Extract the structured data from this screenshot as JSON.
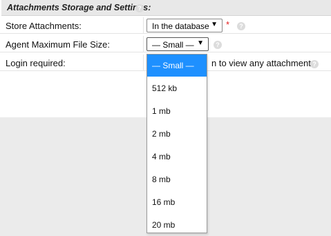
{
  "section": {
    "title": "Attachments Storage and Settings:"
  },
  "rows": [
    {
      "label": "Store Attachments:",
      "select_value": "In the database",
      "required_marker": "*"
    },
    {
      "label": "Agent Maximum File Size:",
      "select_value": "— Small —"
    },
    {
      "label": "Login required:",
      "description": "n to view any attachments"
    }
  ],
  "dropdown": {
    "options": [
      "— Small —",
      "512 kb",
      "1 mb",
      "2 mb",
      "4 mb",
      "8 mb",
      "16 mb",
      "20 mb"
    ],
    "selected_index": 0
  },
  "icons": {
    "help": "question-mark-circle-icon",
    "arrow": "dropdown-arrow-icon"
  },
  "colors": {
    "selected_option": "#1e90ff",
    "required": "#e21b1b",
    "header_bg": "#e8e8e8"
  }
}
